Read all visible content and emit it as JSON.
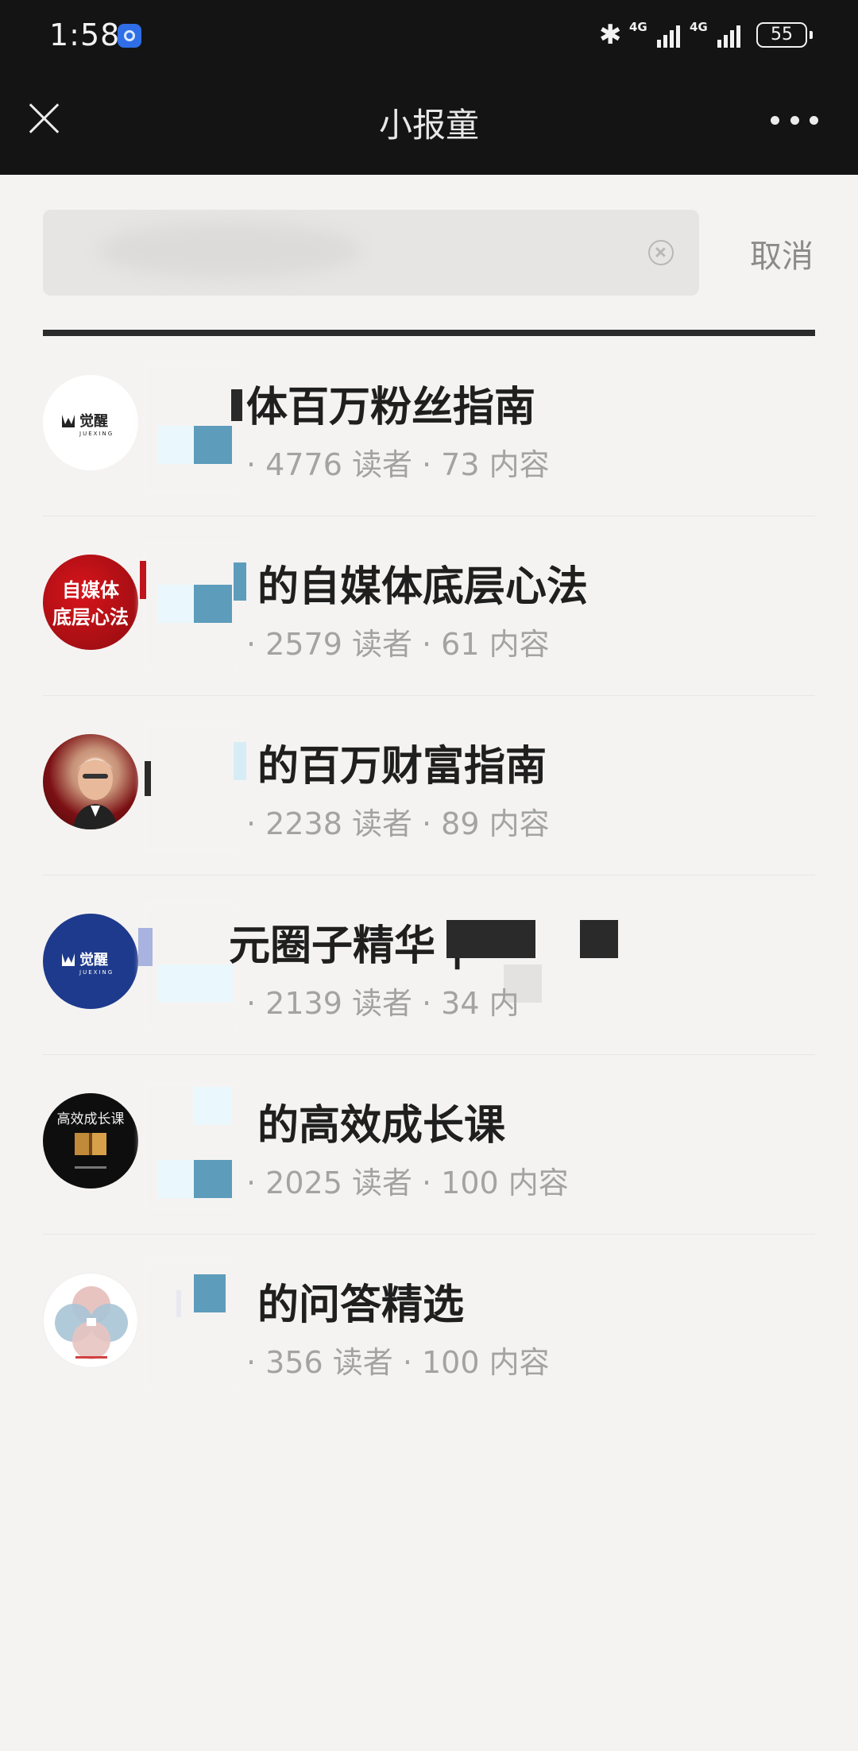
{
  "status_bar": {
    "time": "1:58",
    "network_1": "4G",
    "network_2": "4G",
    "battery": "55"
  },
  "nav": {
    "title": "小报童"
  },
  "search": {
    "value": "",
    "cancel_label": "取消"
  },
  "results": [
    {
      "avatar": "juexing-white-logo",
      "avatar_text": "觉醒",
      "avatar_sub": "JUEXING",
      "title": "体百万粉丝指南",
      "meta": "· 4776 读者 · 73 内容"
    },
    {
      "avatar": "red-banner",
      "avatar_text": "自媒体\n底层心法",
      "title": "的自媒体底层心法",
      "meta": "· 2579 读者 · 61 内容"
    },
    {
      "avatar": "person-photo",
      "title": "的百万财富指南",
      "meta": "· 2238 读者 · 89 内容"
    },
    {
      "avatar": "juexing-blue-logo",
      "avatar_text": "觉醒",
      "avatar_sub": "JUEXING",
      "title": "元圈子精华 |",
      "meta": "· 2139 读者 · 34 内"
    },
    {
      "avatar": "book-black",
      "avatar_text": "高效成长课",
      "title": "的高效成长课",
      "meta": "· 2025 读者 · 100 内容"
    },
    {
      "avatar": "diagram-circle",
      "title": "的问答精选",
      "meta": "· 356 读者 · 100 内容"
    }
  ],
  "colors": {
    "header_bg": "#141414",
    "page_bg": "#f5f3f2",
    "title_text": "#1f1f1f",
    "meta_text": "#a3a3a3",
    "accent_blue": "#1e3a8c",
    "accent_red": "#c0141b"
  }
}
